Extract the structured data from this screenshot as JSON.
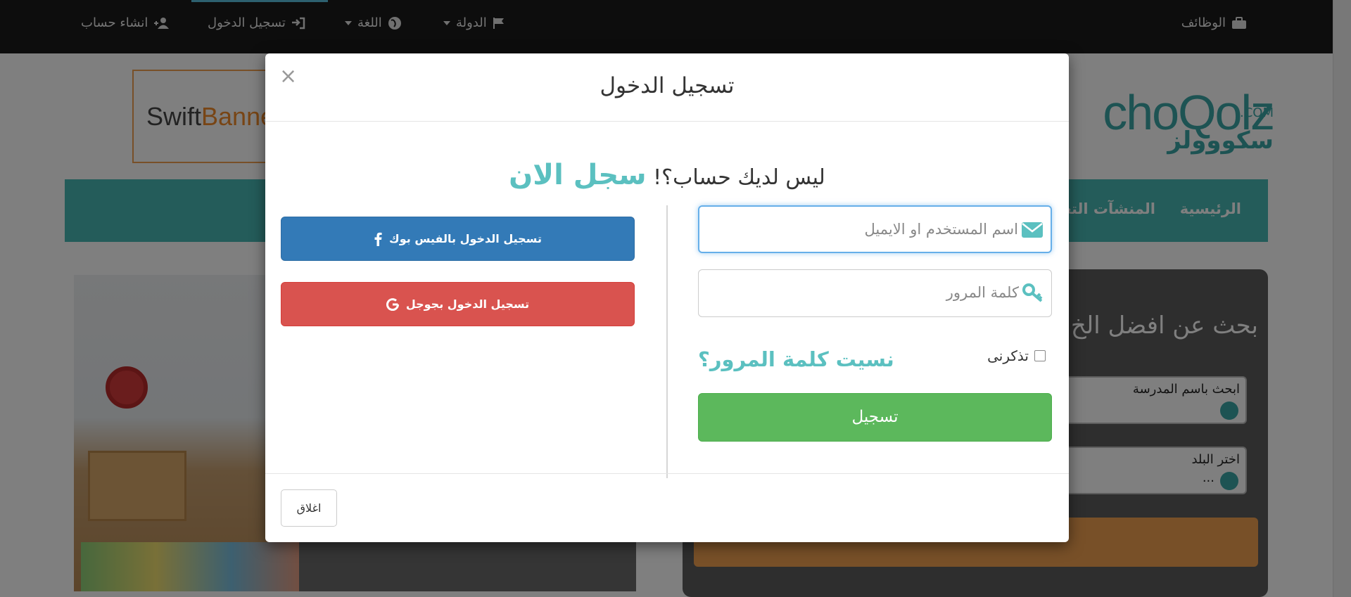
{
  "topbar": {
    "jobs": "الوظائف",
    "country": "الدولة",
    "language": "اللغة",
    "login": "تسجيل الدخول",
    "register": "انشاء حساب"
  },
  "banner": {
    "brand_a": "Swift",
    "brand_b": "Banne"
  },
  "logo": {
    "main": "choQolz",
    "com": ".COM",
    "arabic": "سكووولز"
  },
  "nav": {
    "home": "الرئيسية",
    "institutions": "المنشآت التعل"
  },
  "search_panel": {
    "title": "بحث عن افضل الخ",
    "school_field": "ابحث باسم المدرسة",
    "country_field": "اختر البلد",
    "country_value": "..."
  },
  "modal": {
    "title": "تسجيل الدخول",
    "close_symbol": "×",
    "signup_prompt": "ليس لديك حساب؟!",
    "signup_link": "سجل الان",
    "username_placeholder": "اسم المستخدم او الايميل",
    "password_placeholder": "كلمة المرور",
    "remember_label": "تذكرنى",
    "forgot_link": "نسيت كلمة المرور؟",
    "submit_label": "تسجيل",
    "facebook_label": "تسجيل الدخول بالفيس بوك",
    "google_label": "تسجيل الدخول بجوجل",
    "close_button": "اغلاق"
  },
  "colors": {
    "teal": "#5bc0c0",
    "submit_green": "#5cb85c",
    "facebook_blue": "#337ab7",
    "google_red": "#d9534f",
    "nav_teal": "#49b8b4"
  }
}
